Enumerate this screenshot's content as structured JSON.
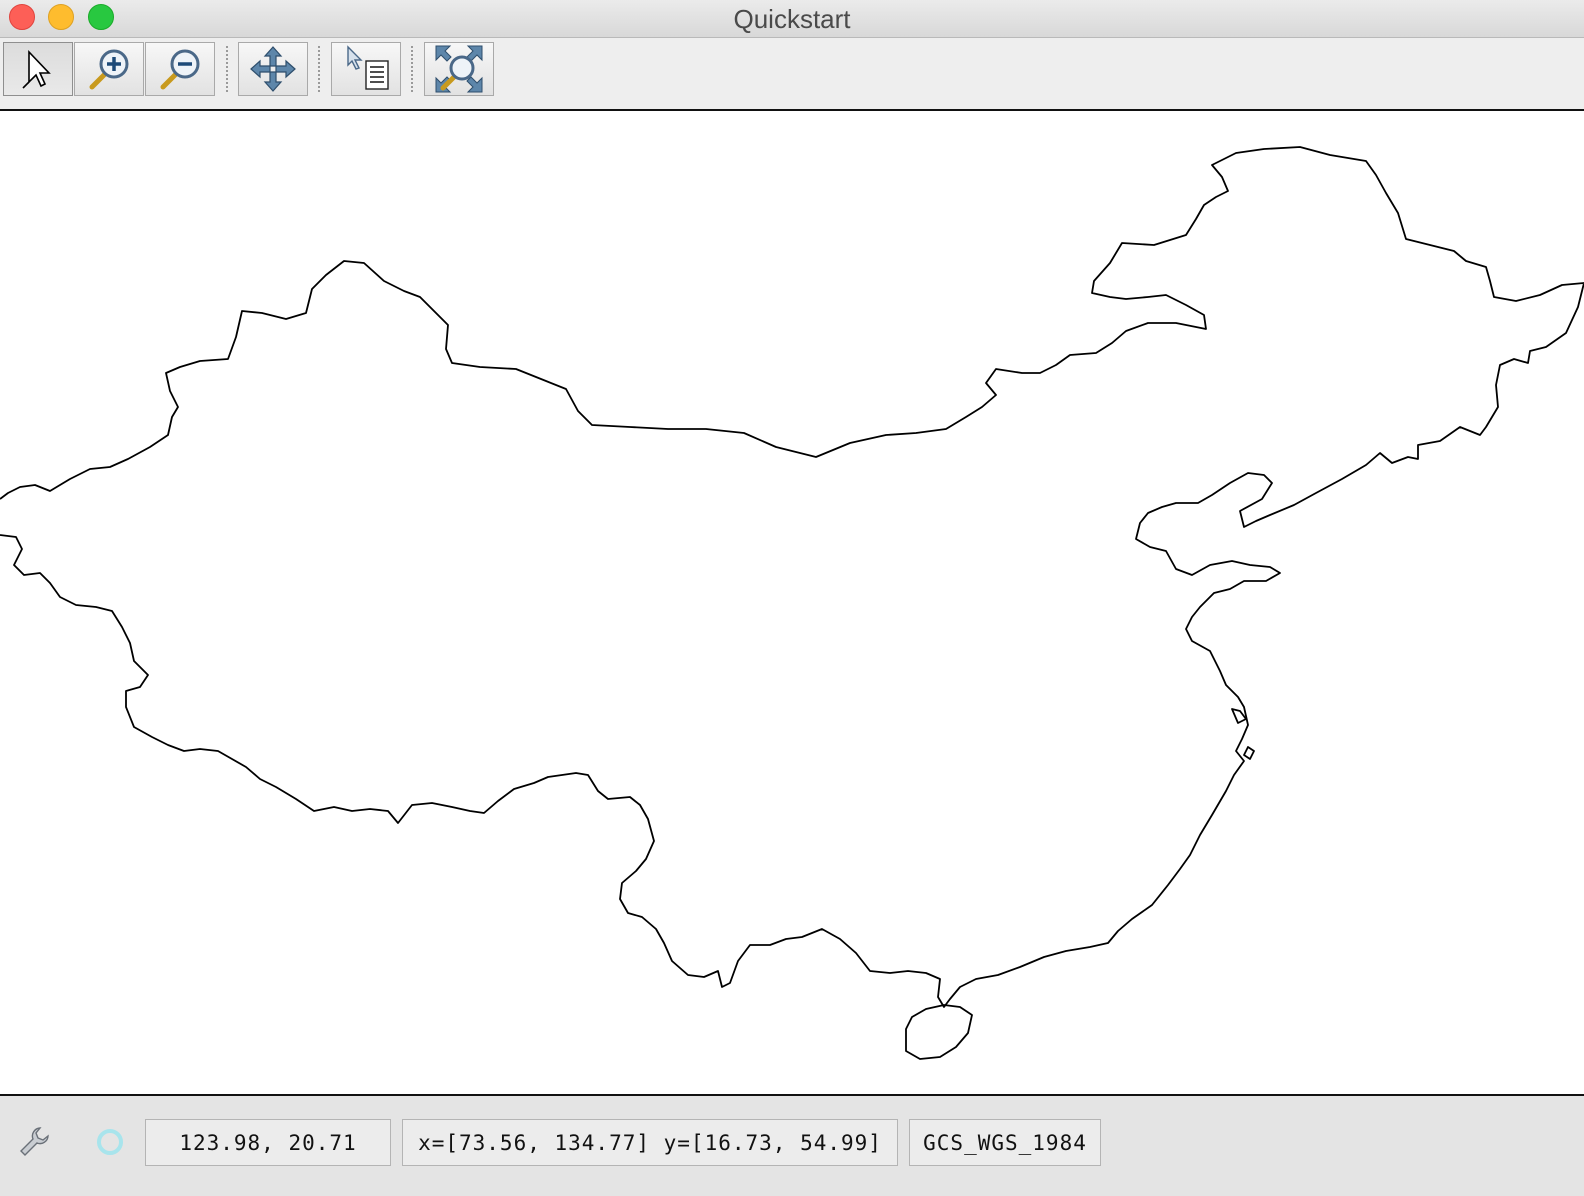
{
  "window": {
    "title": "Quickstart"
  },
  "toolbar": {
    "buttons": [
      {
        "name": "pointer-tool",
        "icon": "arrow-cursor-icon",
        "active": true
      },
      {
        "name": "zoom-in-tool",
        "icon": "zoom-in-icon"
      },
      {
        "name": "zoom-out-tool",
        "icon": "zoom-out-icon"
      },
      {
        "name": "pan-tool",
        "icon": "pan-arrows-icon"
      },
      {
        "name": "info-tool",
        "icon": "info-pointer-icon"
      },
      {
        "name": "zoom-extent-tool",
        "icon": "zoom-extent-icon"
      }
    ]
  },
  "map": {
    "layer": "country outline",
    "stroke_color": "#000000",
    "background": "#ffffff"
  },
  "status": {
    "cursor_coords": "123.98, 20.71",
    "extent": "x=[73.56, 134.77] y=[16.73, 54.99]",
    "crs": "GCS_WGS_1984",
    "icons": [
      "wrench-icon",
      "render-status-icon"
    ]
  }
}
